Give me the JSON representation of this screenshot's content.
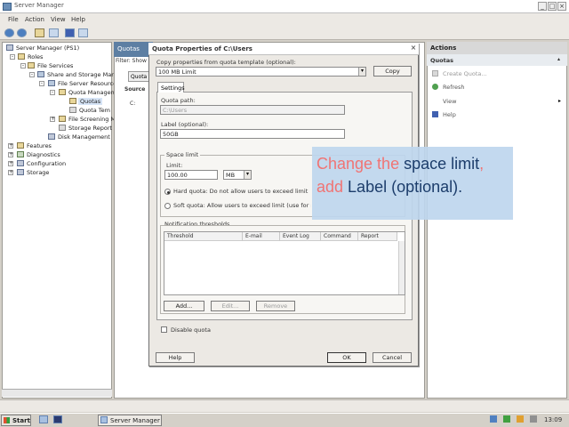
{
  "window": {
    "title": "Server Manager",
    "minimize": "_",
    "maximize": "□",
    "close": "×"
  },
  "menu": {
    "items": [
      "File",
      "Action",
      "View",
      "Help"
    ]
  },
  "toolbar": {
    "icons": [
      "back-arrow-icon",
      "forward-arrow-icon",
      "up-folder-icon",
      "show-hide-tree-icon",
      "help-icon",
      "properties-icon"
    ]
  },
  "tree": {
    "items": [
      {
        "label": "Server Manager (PS1)",
        "icon": "server-icon"
      },
      {
        "label": "Roles",
        "icon": "roles-icon"
      },
      {
        "label": "File Services",
        "icon": "folder-icon"
      },
      {
        "label": "Share and Storage Man",
        "icon": "share-icon"
      },
      {
        "label": "File Server Resource",
        "icon": "fsrm-icon"
      },
      {
        "label": "Quota Managem",
        "icon": "quota-icon"
      },
      {
        "label": "Quotas",
        "icon": "quota-icon"
      },
      {
        "label": "Quota Tem",
        "icon": "template-icon"
      },
      {
        "label": "File Screening M",
        "icon": "screen-icon"
      },
      {
        "label": "Storage Report",
        "icon": "report-icon"
      },
      {
        "label": "Disk Management",
        "icon": "disk-icon"
      },
      {
        "label": "Features",
        "icon": "features-icon"
      },
      {
        "label": "Diagnostics",
        "icon": "diagnostics-icon"
      },
      {
        "label": "Configuration",
        "icon": "configuration-icon"
      },
      {
        "label": "Storage",
        "icon": "storage-icon"
      }
    ]
  },
  "center": {
    "tab": "Quotas",
    "filter_label": "Filter: Show",
    "quota_tab": "Quota",
    "source_label": "Source",
    "row_c": "C:"
  },
  "actions": {
    "header": "Actions",
    "section": "Quotas",
    "items": [
      {
        "label": "Create Quota...",
        "icon": "create-quota-icon",
        "enabled": false
      },
      {
        "label": "Refresh",
        "icon": "refresh-icon",
        "enabled": true
      },
      {
        "label": "View",
        "icon": "view-icon",
        "enabled": true
      },
      {
        "label": "Help",
        "icon": "help-icon",
        "enabled": true
      }
    ],
    "view_arrow": "▸",
    "section_arrow": "▴"
  },
  "dialog": {
    "title": "Quota Properties of C:\\Users",
    "close": "×",
    "copy_label": "Copy properties from quota template (optional):",
    "template_value": "100 MB Limit",
    "copy_button": "Copy",
    "settings_tab": "Settings",
    "quota_path_label": "Quota path:",
    "quota_path_value": "C:\\Users",
    "label_label": "Label (optional):",
    "label_value": "50GB",
    "space_limit_group": "Space limit",
    "limit_label": "Limit:",
    "limit_value": "100.00",
    "unit_value": "MB",
    "hard_quota": "Hard quota: Do not allow users to exceed limit",
    "soft_quota": "Soft quota: Allow users to exceed limit (use for monitoring)",
    "hard_checked": true,
    "notification_group": "Notification thresholds",
    "columns": [
      "Threshold",
      "E-mail",
      "Event Log",
      "Command",
      "Report"
    ],
    "add_button": "Add...",
    "edit_button": "Edit...",
    "remove_button": "Remove",
    "disable_quota": "Disable quota",
    "help_button": "Help",
    "ok_button": "OK",
    "cancel_button": "Cancel"
  },
  "callout": {
    "part1": "Change the ",
    "part2": "space limit",
    "part3": ", add ",
    "part4": "Label (optional).",
    "highlight_color": "#f07474",
    "text_color": "#1c3d6b"
  },
  "taskbar": {
    "start": "Start",
    "task": "Server Manager",
    "clock": "13:09"
  }
}
